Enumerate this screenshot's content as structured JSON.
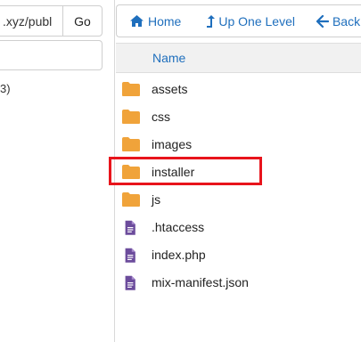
{
  "left_pane": {
    "path_value": ".xyz/publ",
    "go_label": "Go",
    "tree_fragment": "3)"
  },
  "toolbar": {
    "home_label": "Home",
    "up_label": "Up One Level",
    "back_label": "Back",
    "accent_color": "#1f6fbd"
  },
  "table": {
    "column_name": "Name",
    "rows": [
      {
        "name": "assets",
        "type": "folder-icon"
      },
      {
        "name": "css",
        "type": "folder-icon"
      },
      {
        "name": "images",
        "type": "folder-icon"
      },
      {
        "name": "installer",
        "type": "folder-icon"
      },
      {
        "name": "js",
        "type": "folder-icon"
      },
      {
        "name": ".htaccess",
        "type": "file-icon"
      },
      {
        "name": "index.php",
        "type": "file-icon"
      },
      {
        "name": "mix-manifest.json",
        "type": "file-icon"
      }
    ]
  },
  "highlight": {
    "target": "installer",
    "color": "#e8141c"
  }
}
